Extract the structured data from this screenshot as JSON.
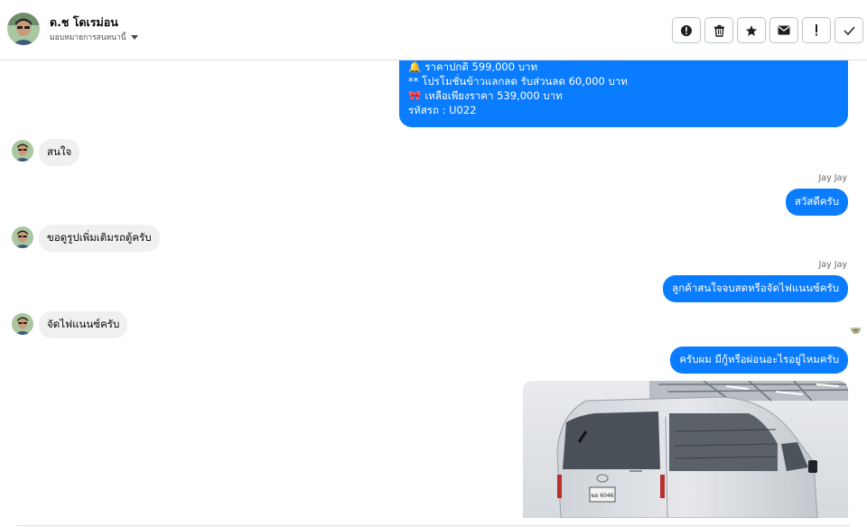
{
  "header": {
    "contact_name": "ด.ช โดเรม่อน",
    "assign_label": "มอบหมายการสนทนานี้",
    "actions": [
      {
        "icon": "alert-circle-icon",
        "name": "mark-spam-button"
      },
      {
        "icon": "trash-icon",
        "name": "delete-button"
      },
      {
        "icon": "star-icon",
        "name": "star-button"
      },
      {
        "icon": "envelope-icon",
        "name": "mark-unread-button"
      },
      {
        "icon": "exclamation-icon",
        "name": "follow-up-button"
      },
      {
        "icon": "check-icon",
        "name": "done-button"
      }
    ]
  },
  "thread": {
    "product_message": {
      "lines": [
        {
          "emoji": "🔔",
          "text": "ราคาปกติ 599,000 บาท"
        },
        {
          "emoji": "",
          "text": "** โปรโมชั่นข้าวแลกลด รับส่วนลด 60,000 บาท"
        },
        {
          "emoji": "🎀",
          "text": " เหลือเพียงราคา 539,000 บาท"
        },
        {
          "emoji": "",
          "text": " รหัสรถ : U022"
        }
      ]
    },
    "messages": [
      {
        "dir": "in",
        "text": "สนใจ"
      },
      {
        "dir": "out",
        "sender": "Jay Jay",
        "text": "สวัสดีครับ"
      },
      {
        "dir": "in",
        "text": "ขอดูรูปเพิ่มเติมรถตู้ครับ"
      },
      {
        "dir": "out",
        "sender": "Jay Jay",
        "text": "ลูกค้าสนใจจบสดหรือจัดไฟแนนซ์ครับ"
      },
      {
        "dir": "in",
        "text": "จัดไฟแนนซ์ครับ"
      },
      {
        "dir": "out",
        "text": "ครับผม มีกู้หรือผ่อนอะไรอยู่ไหมครับ"
      }
    ],
    "photo": {
      "plate": "ฆย 6046"
    }
  },
  "colors": {
    "outgoing_bubble": "#0a7cff",
    "incoming_bubble": "#f0f0f0",
    "text_primary": "#050505",
    "text_secondary": "#65676b"
  }
}
